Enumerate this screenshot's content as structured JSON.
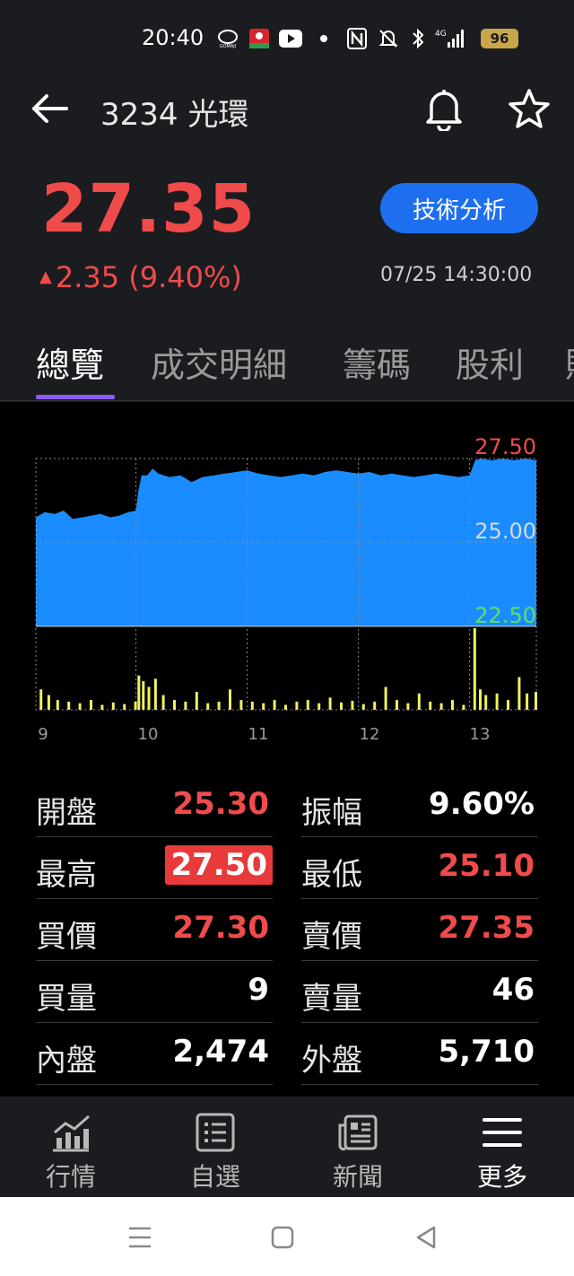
{
  "status_bar": {
    "time": "20:40",
    "icons": [
      "gomaji-app-icon",
      "red-app-icon",
      "youtube-icon",
      "dot-icon",
      "nfc-icon",
      "mute-icon",
      "bluetooth-icon",
      "signal-4g-icon"
    ],
    "battery": "96"
  },
  "header": {
    "title": "3234 光環",
    "price": "27.35",
    "change": "2.35 (9.40%)",
    "timestamp": "07/25 14:30:00",
    "tech_button": "技術分析"
  },
  "tabs": [
    {
      "label": "總覽",
      "active": true
    },
    {
      "label": "成交明細",
      "active": false
    },
    {
      "label": "籌碼",
      "active": false
    },
    {
      "label": "股利",
      "active": false
    },
    {
      "label": "財",
      "active": false
    }
  ],
  "chart_data": {
    "type": "area",
    "price_axis_labels": {
      "high": "27.50",
      "mid": "25.00",
      "low": "22.50"
    },
    "ylim": [
      22.5,
      27.5
    ],
    "x_ticks": [
      "9",
      "10",
      "11",
      "12",
      "13"
    ],
    "price_series": [
      {
        "t": 0.0,
        "p": 25.75
      },
      {
        "t": 0.08,
        "p": 25.9
      },
      {
        "t": 0.17,
        "p": 25.85
      },
      {
        "t": 0.25,
        "p": 25.95
      },
      {
        "t": 0.33,
        "p": 25.7
      },
      {
        "t": 0.42,
        "p": 25.75
      },
      {
        "t": 0.5,
        "p": 25.8
      },
      {
        "t": 0.58,
        "p": 25.85
      },
      {
        "t": 0.67,
        "p": 25.75
      },
      {
        "t": 0.75,
        "p": 25.8
      },
      {
        "t": 0.83,
        "p": 25.9
      },
      {
        "t": 0.9,
        "p": 25.95
      },
      {
        "t": 0.92,
        "p": 26.5
      },
      {
        "t": 0.95,
        "p": 27.0
      },
      {
        "t": 1.0,
        "p": 27.0
      },
      {
        "t": 1.05,
        "p": 27.2
      },
      {
        "t": 1.1,
        "p": 27.05
      },
      {
        "t": 1.2,
        "p": 26.95
      },
      {
        "t": 1.3,
        "p": 27.0
      },
      {
        "t": 1.4,
        "p": 26.8
      },
      {
        "t": 1.5,
        "p": 26.95
      },
      {
        "t": 1.6,
        "p": 27.0
      },
      {
        "t": 1.7,
        "p": 27.05
      },
      {
        "t": 1.8,
        "p": 27.1
      },
      {
        "t": 1.9,
        "p": 27.15
      },
      {
        "t": 2.0,
        "p": 27.05
      },
      {
        "t": 2.1,
        "p": 27.0
      },
      {
        "t": 2.2,
        "p": 26.95
      },
      {
        "t": 2.3,
        "p": 27.0
      },
      {
        "t": 2.4,
        "p": 27.05
      },
      {
        "t": 2.5,
        "p": 27.0
      },
      {
        "t": 2.6,
        "p": 27.1
      },
      {
        "t": 2.7,
        "p": 27.15
      },
      {
        "t": 2.8,
        "p": 27.1
      },
      {
        "t": 2.9,
        "p": 27.05
      },
      {
        "t": 3.0,
        "p": 27.1
      },
      {
        "t": 3.1,
        "p": 27.0
      },
      {
        "t": 3.2,
        "p": 27.05
      },
      {
        "t": 3.3,
        "p": 27.0
      },
      {
        "t": 3.4,
        "p": 26.95
      },
      {
        "t": 3.5,
        "p": 27.0
      },
      {
        "t": 3.6,
        "p": 27.05
      },
      {
        "t": 3.7,
        "p": 27.0
      },
      {
        "t": 3.8,
        "p": 26.95
      },
      {
        "t": 3.9,
        "p": 27.0
      },
      {
        "t": 3.95,
        "p": 27.45
      },
      {
        "t": 4.0,
        "p": 27.5
      },
      {
        "t": 4.1,
        "p": 27.45
      },
      {
        "t": 4.2,
        "p": 27.5
      },
      {
        "t": 4.3,
        "p": 27.45
      },
      {
        "t": 4.4,
        "p": 27.5
      },
      {
        "t": 4.5,
        "p": 27.45
      }
    ],
    "volume_bars": [
      {
        "t": 0.05,
        "v": 0.25
      },
      {
        "t": 0.12,
        "v": 0.18
      },
      {
        "t": 0.2,
        "v": 0.12
      },
      {
        "t": 0.3,
        "v": 0.1
      },
      {
        "t": 0.4,
        "v": 0.08
      },
      {
        "t": 0.5,
        "v": 0.12
      },
      {
        "t": 0.6,
        "v": 0.06
      },
      {
        "t": 0.7,
        "v": 0.09
      },
      {
        "t": 0.8,
        "v": 0.07
      },
      {
        "t": 0.9,
        "v": 0.1
      },
      {
        "t": 0.93,
        "v": 0.42
      },
      {
        "t": 0.97,
        "v": 0.35
      },
      {
        "t": 1.02,
        "v": 0.28
      },
      {
        "t": 1.08,
        "v": 0.38
      },
      {
        "t": 1.15,
        "v": 0.18
      },
      {
        "t": 1.25,
        "v": 0.12
      },
      {
        "t": 1.35,
        "v": 0.1
      },
      {
        "t": 1.45,
        "v": 0.22
      },
      {
        "t": 1.55,
        "v": 0.08
      },
      {
        "t": 1.65,
        "v": 0.1
      },
      {
        "t": 1.75,
        "v": 0.25
      },
      {
        "t": 1.85,
        "v": 0.12
      },
      {
        "t": 1.95,
        "v": 0.1
      },
      {
        "t": 2.05,
        "v": 0.08
      },
      {
        "t": 2.15,
        "v": 0.12
      },
      {
        "t": 2.25,
        "v": 0.06
      },
      {
        "t": 2.35,
        "v": 0.1
      },
      {
        "t": 2.45,
        "v": 0.12
      },
      {
        "t": 2.55,
        "v": 0.08
      },
      {
        "t": 2.65,
        "v": 0.15
      },
      {
        "t": 2.75,
        "v": 0.09
      },
      {
        "t": 2.85,
        "v": 0.11
      },
      {
        "t": 2.95,
        "v": 0.07
      },
      {
        "t": 3.05,
        "v": 0.1
      },
      {
        "t": 3.15,
        "v": 0.28
      },
      {
        "t": 3.25,
        "v": 0.12
      },
      {
        "t": 3.35,
        "v": 0.08
      },
      {
        "t": 3.45,
        "v": 0.2
      },
      {
        "t": 3.55,
        "v": 0.1
      },
      {
        "t": 3.65,
        "v": 0.08
      },
      {
        "t": 3.75,
        "v": 0.12
      },
      {
        "t": 3.85,
        "v": 0.06
      },
      {
        "t": 3.95,
        "v": 1.0
      },
      {
        "t": 4.0,
        "v": 0.25
      },
      {
        "t": 4.05,
        "v": 0.18
      },
      {
        "t": 4.15,
        "v": 0.2
      },
      {
        "t": 4.25,
        "v": 0.12
      },
      {
        "t": 4.35,
        "v": 0.4
      },
      {
        "t": 4.42,
        "v": 0.2
      },
      {
        "t": 4.5,
        "v": 0.22
      }
    ]
  },
  "stats": [
    {
      "label": "開盤",
      "value": "25.30",
      "color": "red"
    },
    {
      "label": "振幅",
      "value": "9.60%",
      "color": "white"
    },
    {
      "label": "最高",
      "value": "27.50",
      "color": "highlight"
    },
    {
      "label": "最低",
      "value": "25.10",
      "color": "red"
    },
    {
      "label": "買價",
      "value": "27.30",
      "color": "red"
    },
    {
      "label": "賣價",
      "value": "27.35",
      "color": "red"
    },
    {
      "label": "買量",
      "value": "9",
      "color": "white"
    },
    {
      "label": "賣量",
      "value": "46",
      "color": "white"
    },
    {
      "label": "內盤",
      "value": "2,474",
      "color": "white"
    },
    {
      "label": "外盤",
      "value": "5,710",
      "color": "white"
    }
  ],
  "bottom_nav": [
    {
      "label": "行情",
      "icon": "chart-icon",
      "active": false
    },
    {
      "label": "自選",
      "icon": "list-icon",
      "active": false
    },
    {
      "label": "新聞",
      "icon": "news-icon",
      "active": false
    },
    {
      "label": "更多",
      "icon": "menu-icon",
      "active": true
    }
  ],
  "colors": {
    "up": "#f04b4b",
    "accent_blue": "#1e6ff0",
    "tab_indicator": "#8a5cf0",
    "chart_fill": "#1a8cff",
    "volume": "#f0f060",
    "low_label": "#5fe05f"
  }
}
